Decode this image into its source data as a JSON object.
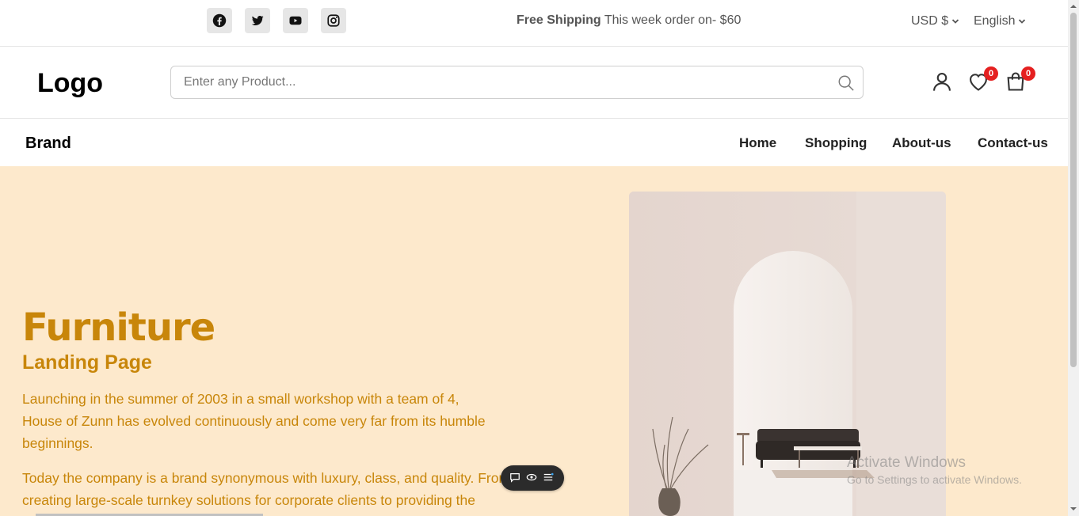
{
  "topbar": {
    "social": [
      {
        "name": "facebook-icon"
      },
      {
        "name": "twitter-icon"
      },
      {
        "name": "youtube-icon"
      },
      {
        "name": "instagram-icon"
      }
    ],
    "promo_bold": "Free Shipping",
    "promo_text": "This week order on- $60",
    "currency": "USD $",
    "language": "English"
  },
  "header": {
    "logo": "Logo",
    "search_placeholder": "Enter any Product...",
    "wishlist_count": "0",
    "cart_count": "0"
  },
  "nav": {
    "brand": "Brand",
    "links": [
      "Home",
      "Shopping",
      "About-us",
      "Contact-us"
    ]
  },
  "hero": {
    "title": "Furniture",
    "subtitle": "Landing Page",
    "paragraph1": "Launching in the summer of 2003 in a small workshop with a team of 4, House of Zunn has evolved continuously and come very far from its humble beginnings.",
    "paragraph2": "Today the company is a brand synonymous with luxury, class, and quality. From creating large-scale turnkey solutions for corporate clients to providing the perfect"
  },
  "watermark": {
    "line1": "Activate Windows",
    "line2": "Go to Settings to activate Windows."
  },
  "colors": {
    "accent": "#c8860a",
    "hero_bg": "#fde9cc",
    "badge": "#e52020"
  }
}
